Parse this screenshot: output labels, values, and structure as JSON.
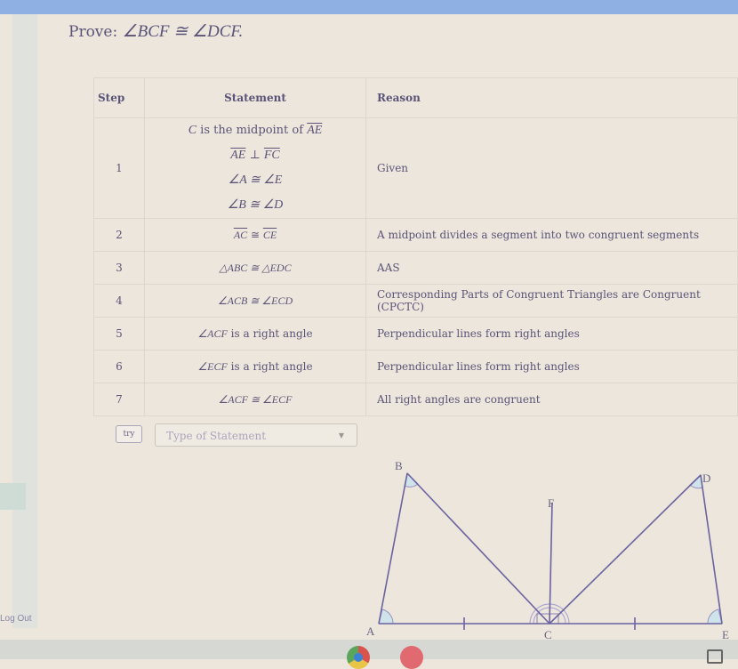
{
  "prove": {
    "label": "Prove:",
    "statement": "∠BCF ≅ ∠DCF."
  },
  "table": {
    "headers": {
      "step": "Step",
      "statement": "Statement",
      "reason": "Reason"
    },
    "rows": [
      {
        "step": "1",
        "statements": [
          {
            "prefix": "C",
            "text": " is the midpoint of ",
            "seg": "AE"
          },
          {
            "segA": "AE",
            "op": " ⊥ ",
            "segB": "FC"
          },
          {
            "math": "∠A ≅ ∠E"
          },
          {
            "math": "∠B ≅ ∠D"
          }
        ],
        "reason": "Given"
      },
      {
        "step": "2",
        "segA": "AC",
        "op": " ≅ ",
        "segB": "CE",
        "reason": "A midpoint divides a segment into two congruent segments"
      },
      {
        "step": "3",
        "math": "△ABC ≅ △EDC",
        "reason": "AAS"
      },
      {
        "step": "4",
        "math": "∠ACB ≅ ∠ECD",
        "reason": "Corresponding Parts of Congruent Triangles are Congruent (CPCTC)"
      },
      {
        "step": "5",
        "math": "∠ACF",
        "suffix": " is a right angle",
        "reason": "Perpendicular lines form right angles"
      },
      {
        "step": "6",
        "math": "∠ECF",
        "suffix": " is a right angle",
        "reason": "Perpendicular lines form right angles"
      },
      {
        "step": "7",
        "math": "∠ACF ≅ ∠ECF",
        "reason": "All right angles are congruent"
      }
    ]
  },
  "input_row": {
    "try_label": "try",
    "select_placeholder": "Type of Statement"
  },
  "diagram": {
    "points": {
      "A": "A",
      "B": "B",
      "C": "C",
      "D": "D",
      "E": "E",
      "F": "F"
    }
  },
  "sidebar": {
    "logout_label": "Log Out"
  },
  "colors": {
    "line": "#6b62a0",
    "angle_fill": "#cfe3ea",
    "text": "#5b5478",
    "top_bar": "#8fb0e2"
  }
}
